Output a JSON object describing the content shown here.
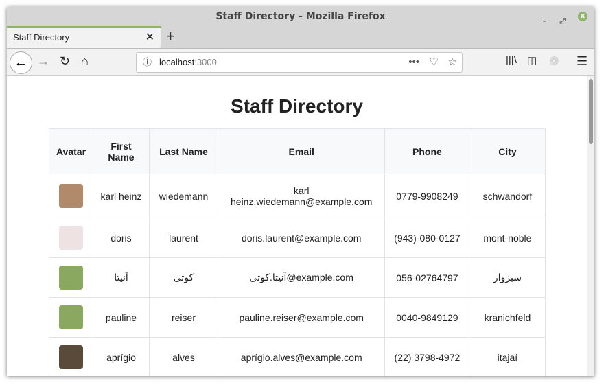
{
  "window": {
    "title": "Staff Directory - Mozilla Firefox"
  },
  "tab": {
    "label": "Staff Directory"
  },
  "url": {
    "host": "localhost",
    "port": ":3000"
  },
  "page": {
    "title": "Staff Directory"
  },
  "table": {
    "headers": [
      "Avatar",
      "First Name",
      "Last Name",
      "Email",
      "Phone",
      "City"
    ],
    "rows": [
      {
        "first": "karl heinz",
        "last": "wiedemann",
        "email": "karl heinz.wiedemann@example.com",
        "phone": "0779-9908249",
        "city": "schwandorf",
        "avatar_color": "#b08a6a"
      },
      {
        "first": "doris",
        "last": "laurent",
        "email": "doris.laurent@example.com",
        "phone": "(943)-080-0127",
        "city": "mont-noble",
        "avatar_color": "#efe2e2"
      },
      {
        "first": "آنیتا",
        "last": "کوتی",
        "email": "آنیتا.کوتی@example.com",
        "phone": "056-02764797",
        "city": "سبزوار",
        "avatar_color": "#8aa860"
      },
      {
        "first": "pauline",
        "last": "reiser",
        "email": "pauline.reiser@example.com",
        "phone": "0040-9849129",
        "city": "kranichfeld",
        "avatar_color": "#8aa860"
      },
      {
        "first": "aprígio",
        "last": "alves",
        "email": "aprígio.alves@example.com",
        "phone": "(22) 3798-4972",
        "city": "itajaí",
        "avatar_color": "#5a4a3a"
      }
    ]
  }
}
